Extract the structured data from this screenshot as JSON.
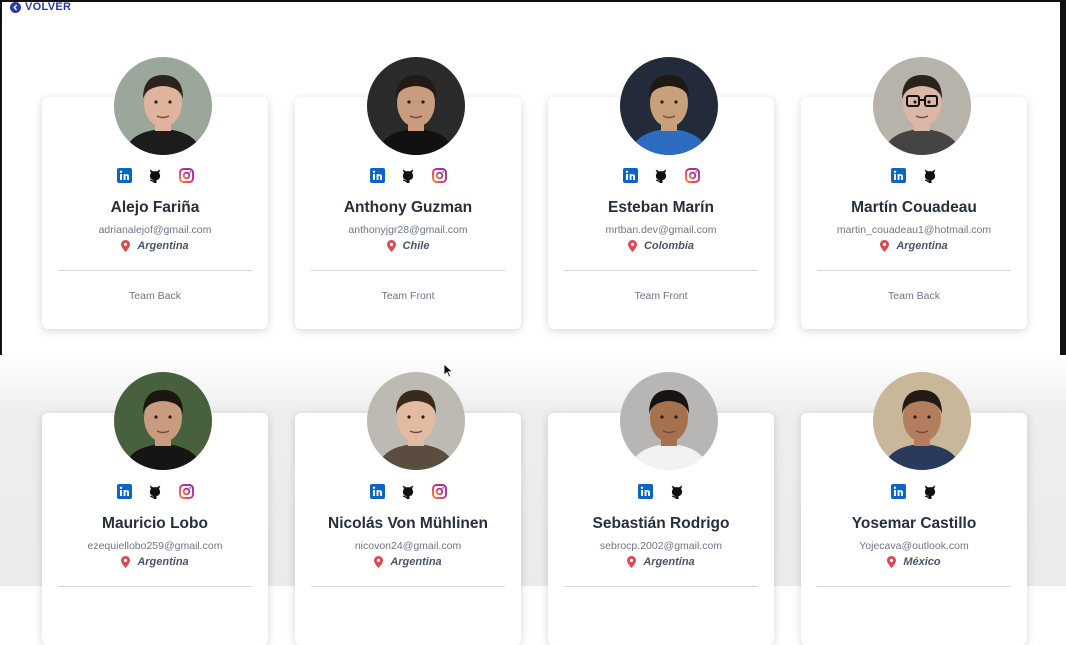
{
  "nav": {
    "back_label": "VOLVER"
  },
  "colors": {
    "linkedin": "#0a66c2",
    "github": "#111111",
    "instagram": "#c13584",
    "pin": "#e0484f",
    "accent": "#2a37a8"
  },
  "members": [
    {
      "name": "Alejo Fariña",
      "email": "adrianalejof@gmail.com",
      "country": "Argentina",
      "team": "Team Back",
      "socials": [
        "linkedin-icon",
        "github-icon",
        "instagram-icon"
      ]
    },
    {
      "name": "Anthony Guzman",
      "email": "anthonyjgr28@gmail.com",
      "country": "Chile",
      "team": "Team Front",
      "socials": [
        "linkedin-icon",
        "github-icon",
        "instagram-icon"
      ]
    },
    {
      "name": "Esteban Marín",
      "email": "mrtban.dev@gmail.com",
      "country": "Colombia",
      "team": "Team Front",
      "socials": [
        "linkedin-icon",
        "github-icon",
        "instagram-icon"
      ]
    },
    {
      "name": "Martín Couadeau",
      "email": "martin_couadeau1@hotmail.com",
      "country": "Argentina",
      "team": "Team Back",
      "socials": [
        "linkedin-icon",
        "github-icon"
      ]
    },
    {
      "name": "Mauricio Lobo",
      "email": "ezequiellobo259@gmail.com",
      "country": "Argentina",
      "socials": [
        "linkedin-icon",
        "github-icon",
        "instagram-icon"
      ]
    },
    {
      "name": "Nicolás Von Mühlinen",
      "email": "nicovon24@gmail.com",
      "country": "Argentina",
      "socials": [
        "linkedin-icon",
        "github-icon",
        "instagram-icon"
      ]
    },
    {
      "name": "Sebastián Rodrigo",
      "email": "sebrocp.2002@gmail.com",
      "country": "Argentina",
      "socials": [
        "linkedin-icon",
        "github-icon"
      ]
    },
    {
      "name": "Yosemar Castillo",
      "email": "Yojecava@outlook.com",
      "country": "México",
      "socials": [
        "linkedin-icon",
        "github-icon"
      ]
    }
  ]
}
